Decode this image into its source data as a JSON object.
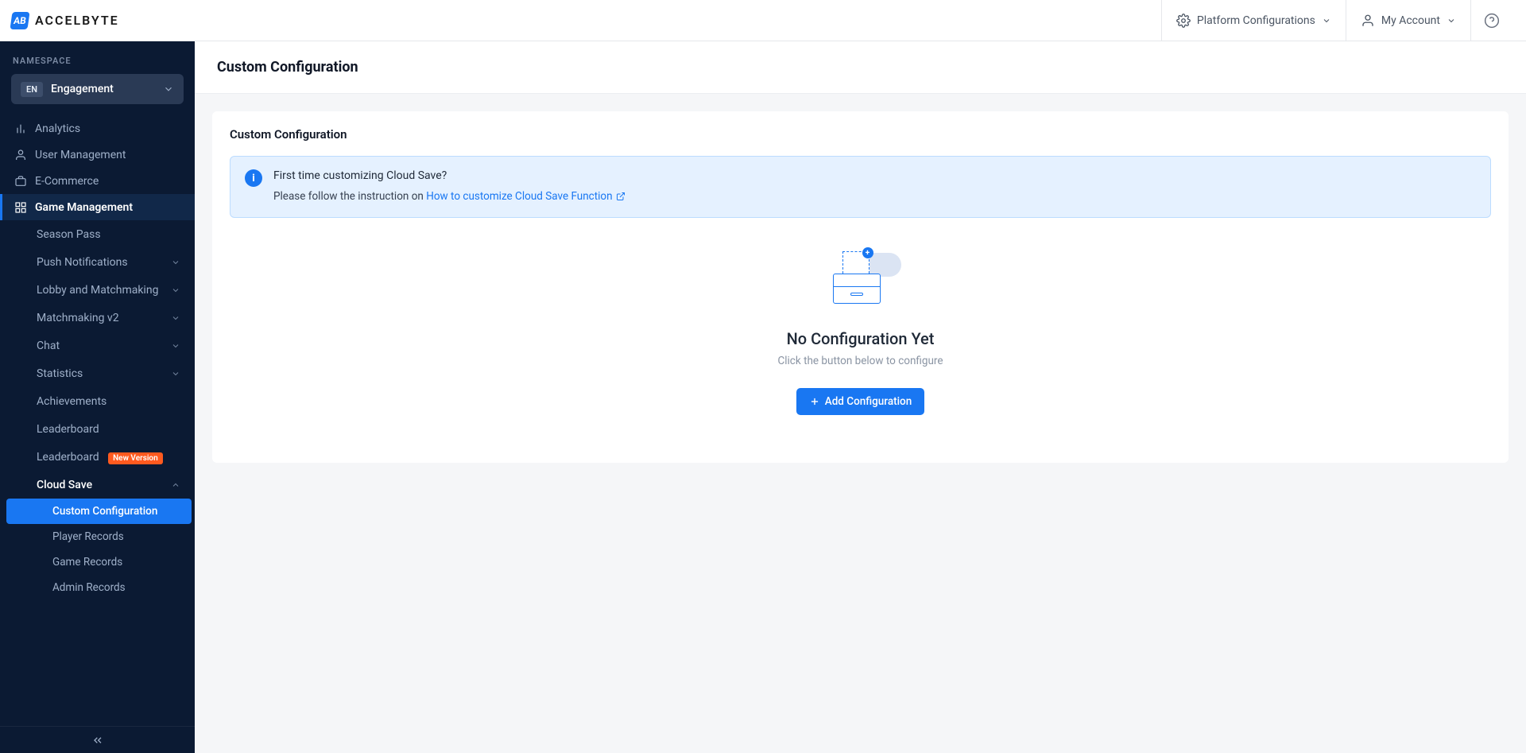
{
  "brand": {
    "logo_text": "AB",
    "name": "ACCELBYTE"
  },
  "topbar": {
    "platform_config": "Platform Configurations",
    "my_account": "My Account"
  },
  "sidebar": {
    "ns_label": "NAMESPACE",
    "ns_badge": "EN",
    "ns_name": "Engagement",
    "top": [
      {
        "label": "Analytics"
      },
      {
        "label": "User Management"
      },
      {
        "label": "E-Commerce"
      },
      {
        "label": "Game Management"
      }
    ],
    "game_mgmt": {
      "items": [
        {
          "label": "Season Pass",
          "expandable": false
        },
        {
          "label": "Push Notifications",
          "expandable": true
        },
        {
          "label": "Lobby and Matchmaking",
          "expandable": true
        },
        {
          "label": "Matchmaking v2",
          "expandable": true
        },
        {
          "label": "Chat",
          "expandable": true
        },
        {
          "label": "Statistics",
          "expandable": true
        },
        {
          "label": "Achievements",
          "expandable": false
        },
        {
          "label": "Leaderboard",
          "expandable": false
        },
        {
          "label": "Leaderboard",
          "expandable": false,
          "badge": "New Version"
        },
        {
          "label": "Cloud Save",
          "expandable": true,
          "open": true
        }
      ],
      "cloud_save_children": [
        {
          "label": "Custom Configuration",
          "active": true
        },
        {
          "label": "Player Records"
        },
        {
          "label": "Game Records"
        },
        {
          "label": "Admin Records"
        }
      ]
    }
  },
  "page": {
    "title": "Custom Configuration",
    "panel_title": "Custom Configuration",
    "info": {
      "heading": "First time customizing Cloud Save?",
      "prefix": "Please follow the instruction on",
      "link_text": "How to customize Cloud Save Function"
    },
    "empty": {
      "title": "No Configuration Yet",
      "subtitle": "Click the button below to configure",
      "button": "Add Configuration"
    }
  }
}
